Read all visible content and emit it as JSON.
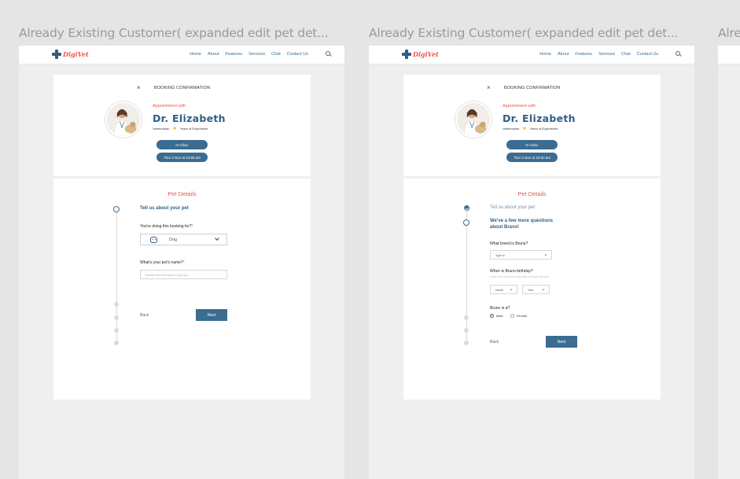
{
  "frames": [
    {
      "title": "Already Existing Customer( expanded edit pet det..."
    },
    {
      "title": "Already Existing Customer( expanded edit pet det..."
    },
    {
      "title": "Alre"
    }
  ],
  "nav": {
    "logo": "DigiVet",
    "links": [
      "Home",
      "About",
      "Features",
      "Services",
      "Chat",
      "Contact Us"
    ],
    "search_icon": "search-icon"
  },
  "booking": {
    "close": "×",
    "title": "BOOKING CONFIRMATION",
    "appointment_with": "Appointment with",
    "doctor": "Dr. Elizabeth",
    "specialty": "Veterinarian",
    "experience": "Years of Experience",
    "mode": "In-Clinic",
    "datetime": "Thur 2 Nov at 10:00 am"
  },
  "pet_step1": {
    "section_title": "Pet Details",
    "heading": "Tell us about your pet",
    "question1": "You're doing this booking for?",
    "required": "*",
    "selected_pet": "Dog",
    "question2": "What's your pet's name?",
    "name_placeholder": "Please enter the name of your pet",
    "back": "Back",
    "next": "Next"
  },
  "pet_step2": {
    "section_title": "Pet Details",
    "done_heading": "Tell us about your pet",
    "heading": "We've a few more questions about Bravo!",
    "breed_question": "What breed is Bruno?",
    "breed_placeholder": "Type to",
    "birthday_question": "When is Bruno birthday?",
    "birthday_help": "If you don't know the exact date, just give the best",
    "month": "Month",
    "year": "Year",
    "gender_question": "Bruno is a?",
    "gender_options": [
      "Male",
      "Female"
    ],
    "back": "Back",
    "next": "Next"
  },
  "colors": {
    "primary": "#3b6c91",
    "accent": "#e8574d",
    "star": "#f5a623"
  }
}
